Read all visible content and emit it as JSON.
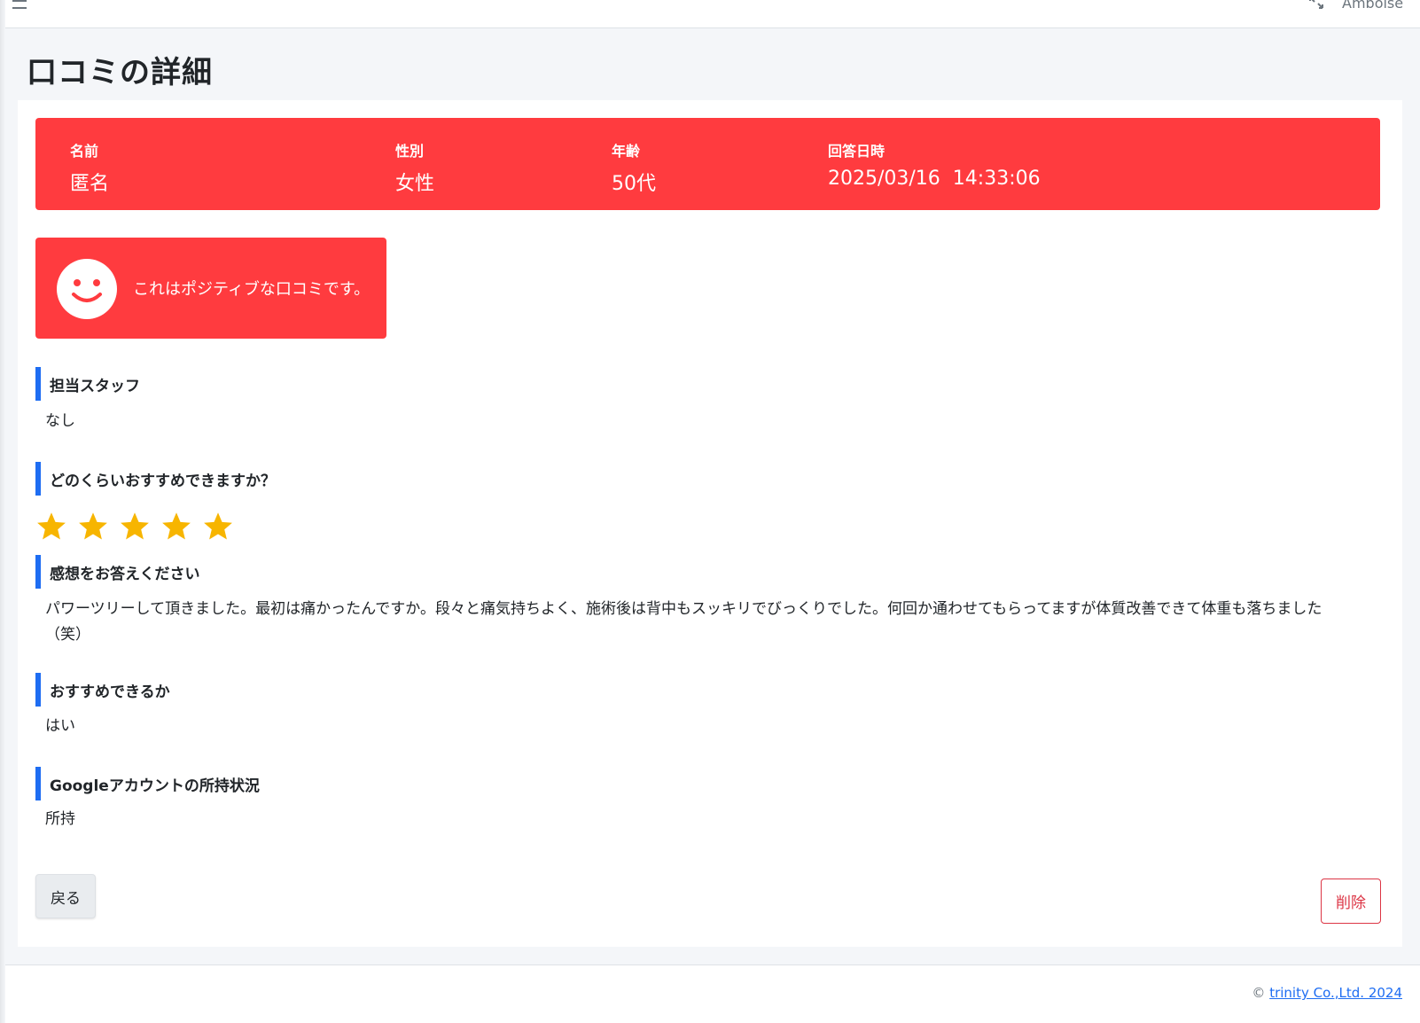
{
  "topbar": {
    "user_name": "Amboise"
  },
  "page": {
    "title": "口コミの詳細"
  },
  "info": {
    "name_label": "名前",
    "name_value": "匿名",
    "gender_label": "性別",
    "gender_value": "女性",
    "age_label": "年齢",
    "age_value": "50代",
    "date_label": "回答日時",
    "date_value": "2025/03/16  14:33:06"
  },
  "sentiment": {
    "text": "これはポジティブな口コミです。",
    "icon": "smiley-icon"
  },
  "sections": {
    "staff": {
      "heading": "担当スタッフ",
      "value": "なし"
    },
    "rating": {
      "heading": "どのくらいおすすめできますか？",
      "stars": 5,
      "max_stars": 5
    },
    "impression": {
      "heading": "感想をお答えください",
      "value": "パワーツリーして頂きました。最初は痛かったんですか。段々と痛気持ちよく、施術後は背中もスッキリでびっくりでした。何回か通わせてもらってますが体質改善できて体重も落ちました（笑）"
    },
    "recommend": {
      "heading": "おすすめできるか",
      "value": "はい"
    },
    "google": {
      "heading": "Googleアカウントの所持状況",
      "value": "所持"
    }
  },
  "buttons": {
    "back_label": "戻る",
    "delete_label": "削除"
  },
  "footer": {
    "copyright_symbol": "©",
    "link_text": "trinity Co.,Ltd. 2024"
  },
  "colors": {
    "banner": "#ff3b3f",
    "accent": "#1e6df2",
    "star": "#f7b500",
    "danger": "#dc3545"
  }
}
